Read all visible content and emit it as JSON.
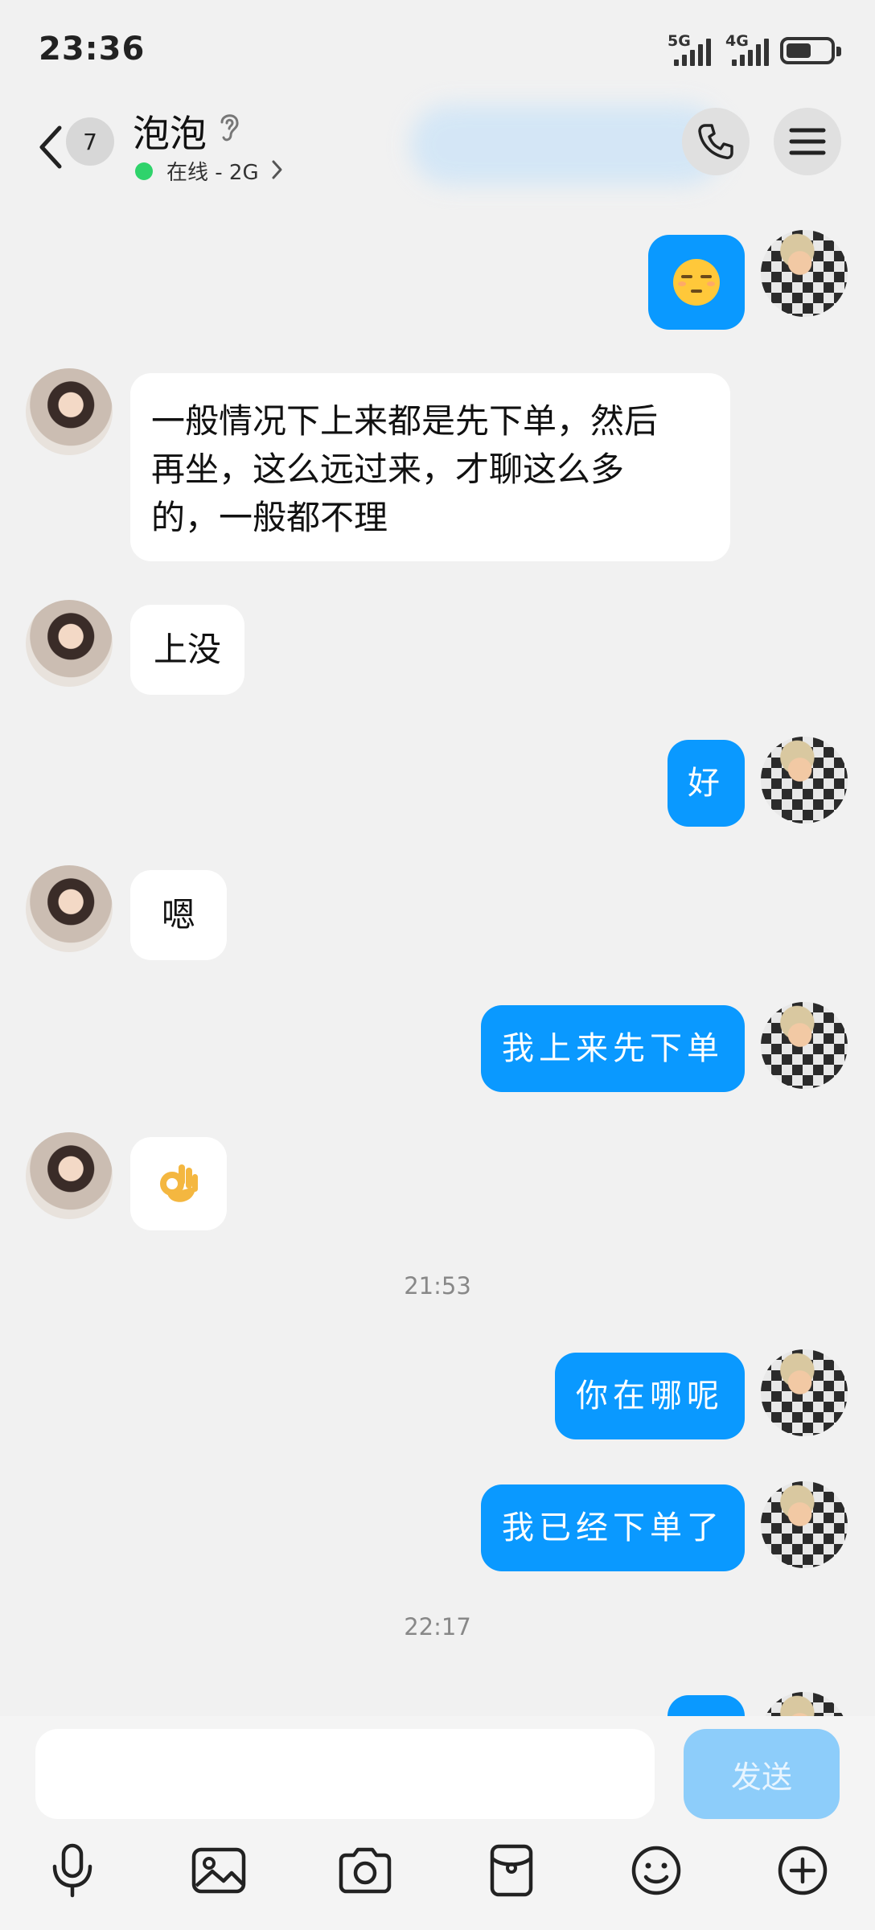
{
  "status_bar": {
    "time": "23:36",
    "signal_1_label": "5G",
    "signal_2_label": "4G",
    "battery_icon": "battery-icon"
  },
  "header": {
    "back_icon": "chevron-left-icon",
    "unread_count": "7",
    "contact_name": "泡泡",
    "ear_icon": "ear-icon",
    "online_status": "在线 - 2G",
    "status_color": "#2fd36b",
    "call_icon": "phone-icon",
    "menu_icon": "menu-icon"
  },
  "messages": [
    {
      "side": "out",
      "type": "emoji",
      "content": "smirk-face-emoji"
    },
    {
      "side": "in",
      "type": "text",
      "lines": [
        "一般情况下上来都是先下单，然后",
        "再坐，这么远过来，才聊这么多",
        "的，一般都不理"
      ]
    },
    {
      "side": "in",
      "type": "text",
      "text": "上没"
    },
    {
      "side": "out",
      "type": "text",
      "text": "好"
    },
    {
      "side": "in",
      "type": "text",
      "text": "嗯"
    },
    {
      "side": "out",
      "type": "text",
      "text": "我上来先下单"
    },
    {
      "side": "in",
      "type": "emoji",
      "content": "ok-hand-emoji"
    },
    {
      "type": "timestamp",
      "text": "21:53"
    },
    {
      "side": "out",
      "type": "text",
      "text": "你在哪呢"
    },
    {
      "side": "out",
      "type": "text",
      "text": "我已经下单了"
    },
    {
      "type": "timestamp",
      "text": "22:17"
    }
  ],
  "input": {
    "value": "",
    "send_label": "发送"
  },
  "toolbar": {
    "icons": [
      "microphone-icon",
      "image-icon",
      "camera-icon",
      "red-packet-icon",
      "emoji-icon",
      "plus-icon"
    ]
  },
  "colors": {
    "outgoing_bubble": "#0a99ff",
    "incoming_bubble": "#ffffff",
    "background": "#f1f1f1",
    "send_button_disabled": "#8dcdfa"
  }
}
